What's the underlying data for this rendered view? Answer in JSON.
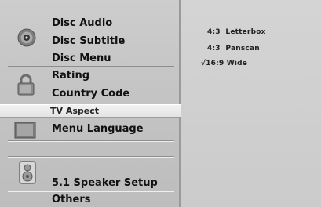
{
  "menu": {
    "items": [
      {
        "label": "Disc Audio"
      },
      {
        "label": "Disc Subtitle"
      },
      {
        "label": "Disc Menu"
      },
      {
        "label": "Rating"
      },
      {
        "label": "Country Code"
      },
      {
        "label": "TV Aspect"
      },
      {
        "label": "Menu Language"
      },
      {
        "label": "5.1 Speaker Setup"
      },
      {
        "label": "Others"
      }
    ],
    "selected_label": "TV Aspect"
  },
  "tv_aspect": {
    "options": [
      {
        "label": "4:3  Letterbox",
        "checked": false
      },
      {
        "label": "4:3  Panscan",
        "checked": false
      },
      {
        "label": "16:9 Wide",
        "checked": true,
        "check_mark": "√"
      }
    ]
  },
  "icons": [
    "disc-icon",
    "lock-icon",
    "tv-icon",
    "speaker-icon"
  ]
}
